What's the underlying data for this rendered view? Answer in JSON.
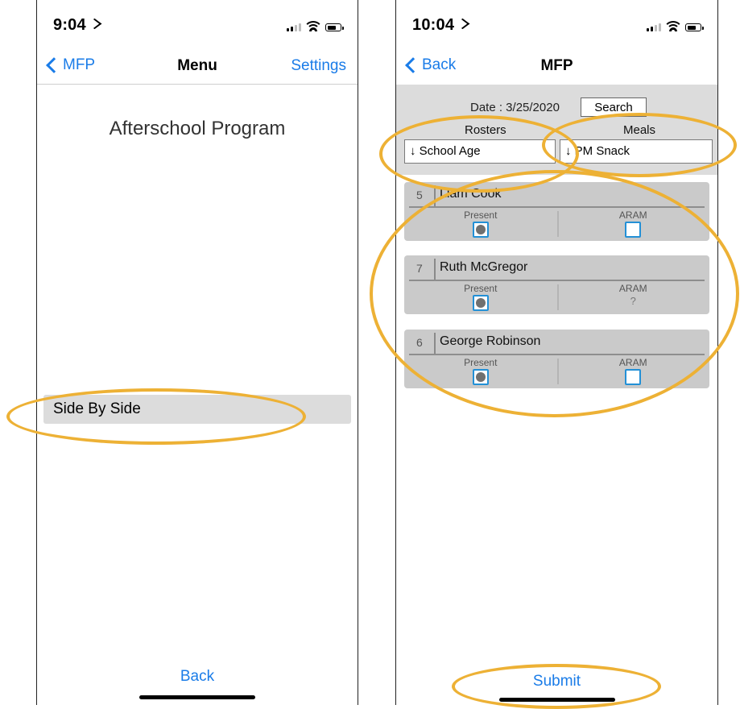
{
  "left_screen": {
    "status": {
      "time": "9:04"
    },
    "nav": {
      "back_label": "MFP",
      "title": "Menu",
      "right_label": "Settings"
    },
    "app_title": "Afterschool Program",
    "menu_items": [
      {
        "label": "Side By Side"
      }
    ],
    "bottom_button": "Back"
  },
  "right_screen": {
    "status": {
      "time": "10:04"
    },
    "nav": {
      "back_label": "Back",
      "title": "MFP"
    },
    "date_label": "Date : 3/25/2020",
    "search_label": "Search",
    "rosters": {
      "label": "Rosters",
      "arrow": "↓",
      "value": "School Age"
    },
    "meals": {
      "label": "Meals",
      "arrow": "↓",
      "value": "PM Snack"
    },
    "records": [
      {
        "number": "5",
        "name": "Liam Cook",
        "present_label": "Present",
        "present": true,
        "aram_label": "ARAM",
        "aram_value": ""
      },
      {
        "number": "7",
        "name": "Ruth McGregor",
        "present_label": "Present",
        "present": true,
        "aram_label": "ARAM",
        "aram_value": "?"
      },
      {
        "number": "6",
        "name": "George Robinson",
        "present_label": "Present",
        "present": true,
        "aram_label": "ARAM",
        "aram_value": ""
      }
    ],
    "submit_label": "Submit"
  },
  "colors": {
    "accent": "#1a7ce8",
    "highlight": "#edb135",
    "panel": "#dcdcdc",
    "card": "#cacaca",
    "checkbox": "#2390d6"
  },
  "icons": [
    "location-arrow-icon",
    "signal-icon",
    "wifi-icon",
    "battery-icon",
    "chevron-left-icon",
    "down-arrow-icon"
  ]
}
